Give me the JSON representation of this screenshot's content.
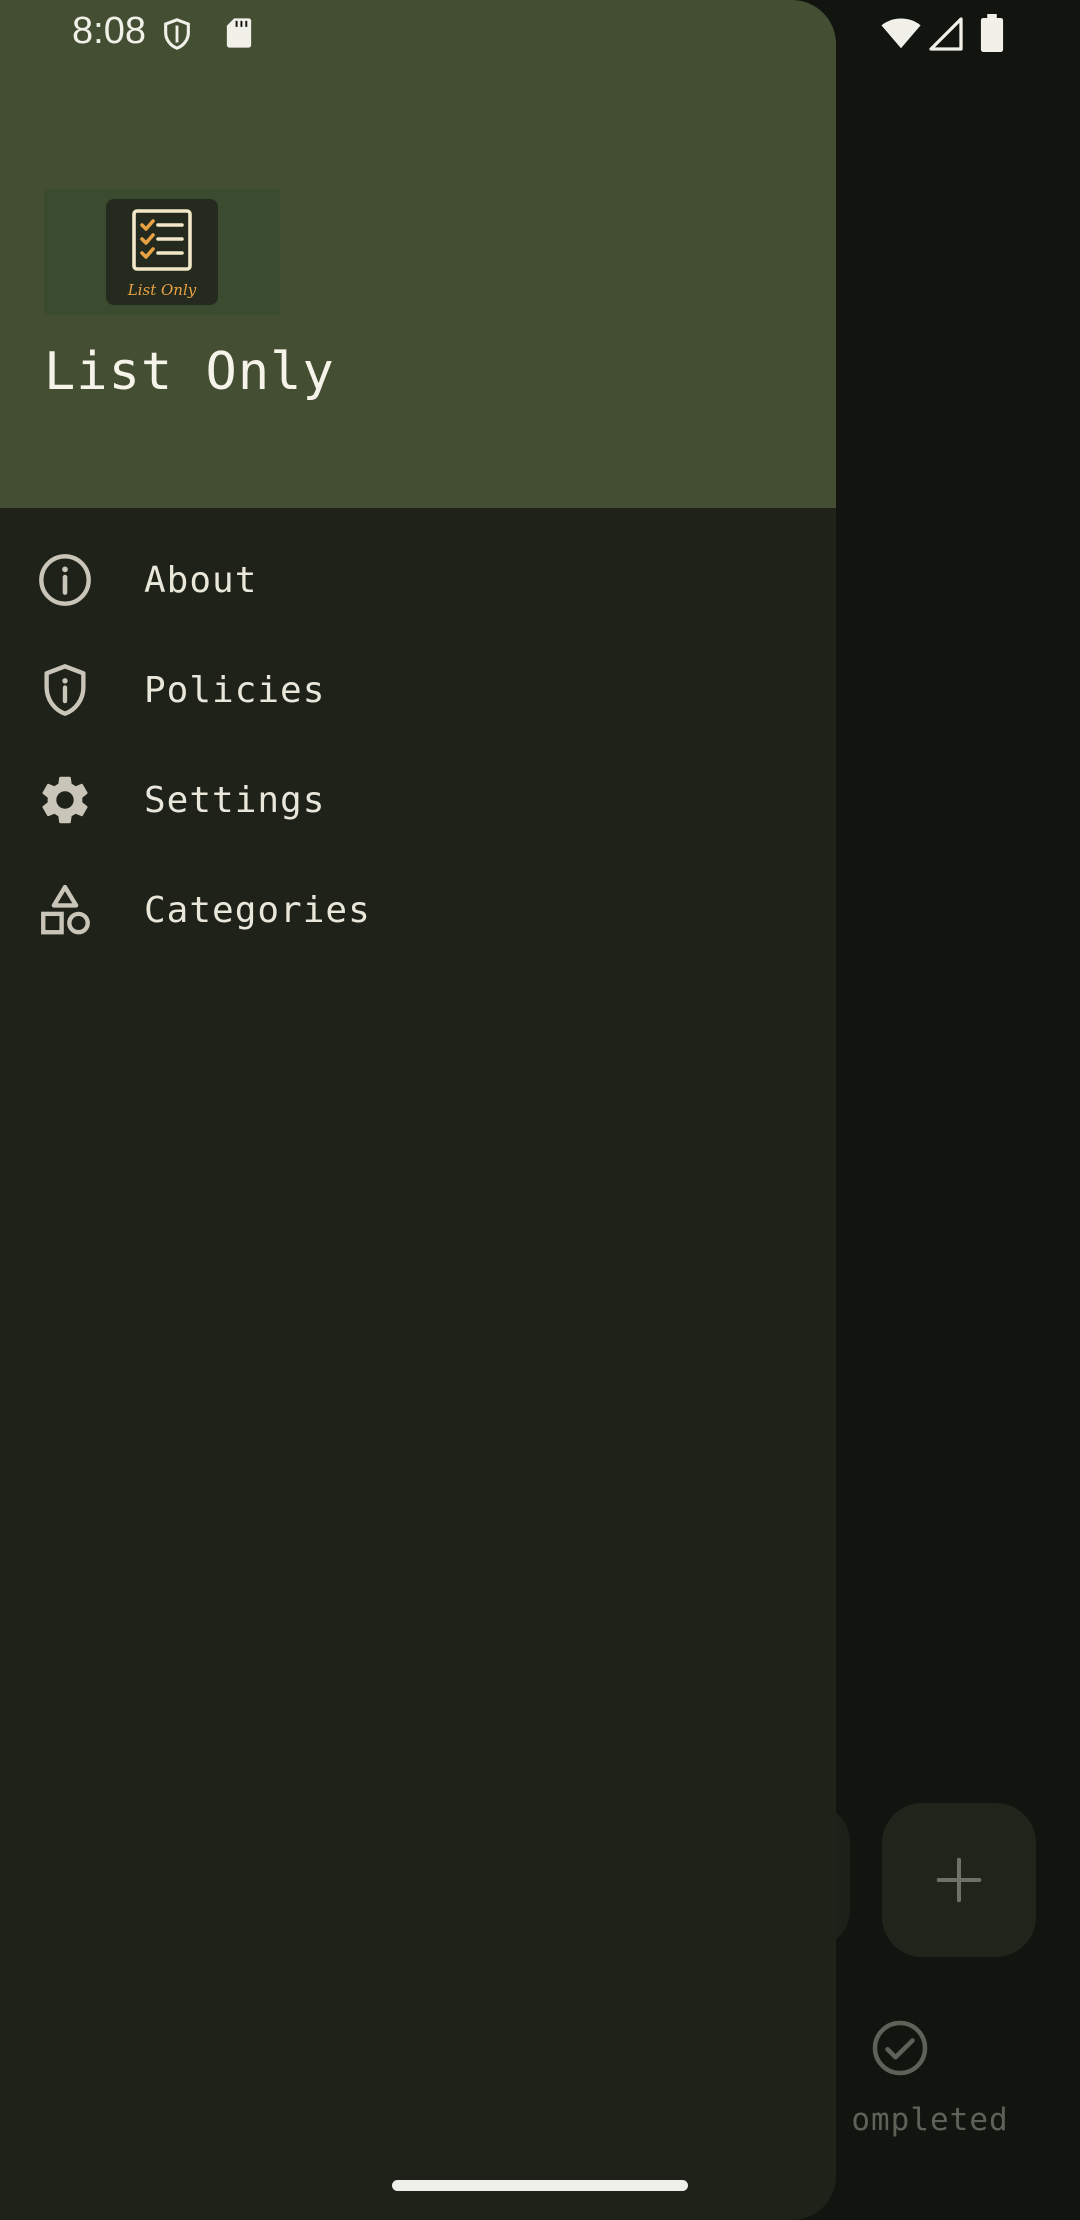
{
  "status_bar": {
    "time": "8:08",
    "icons": [
      "shield-icon",
      "sd-card-icon",
      "wifi-icon",
      "signal-icon",
      "battery-icon"
    ]
  },
  "drawer": {
    "app_title": "List Only",
    "logo_text": "List Only",
    "items": [
      {
        "label": "About",
        "icon": "info-icon"
      },
      {
        "label": "Policies",
        "icon": "shield-info-icon"
      },
      {
        "label": "Settings",
        "icon": "gear-icon"
      },
      {
        "label": "Categories",
        "icon": "shapes-icon"
      }
    ]
  },
  "background": {
    "completed_label": "ompleted",
    "fab_icon": "plus-icon"
  },
  "colors": {
    "drawer_header": "#434e33",
    "drawer_body": "#1e2219",
    "text": "#e9e6da",
    "logo_accent": "#e8a243"
  }
}
